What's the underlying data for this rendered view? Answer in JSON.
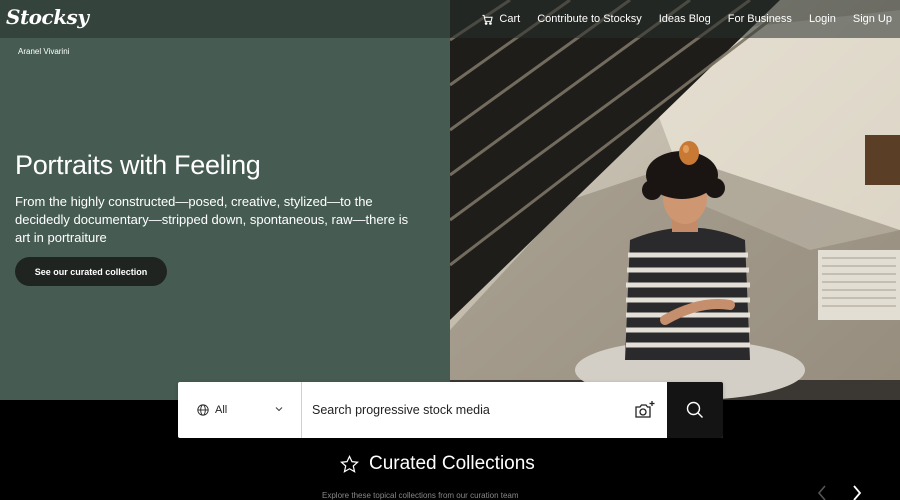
{
  "nav": {
    "logo": "Stocksy",
    "cart_label": "Cart",
    "links": [
      "Contribute to Stocksy",
      "Ideas Blog",
      "For Business",
      "Login",
      "Sign Up"
    ]
  },
  "hero": {
    "credit": "Aranel Vivarini",
    "title": "Portraits with Feeling",
    "description": "From the highly constructed—posed, creative, stylized—to the decidedly documentary—stripped down, spontaneous, raw—there is art in portraiture",
    "cta_label": "See our curated collection",
    "bg_color": "#465c53"
  },
  "search": {
    "scope_label": "All",
    "placeholder": "Search progressive stock media",
    "scope_icon": "globe-icon",
    "visual_search_icon": "camera-plus-icon",
    "submit_icon": "search-icon"
  },
  "collections": {
    "title": "Curated Collections",
    "icon": "star-icon",
    "subtitle": "Explore these topical collections from our curation team"
  }
}
